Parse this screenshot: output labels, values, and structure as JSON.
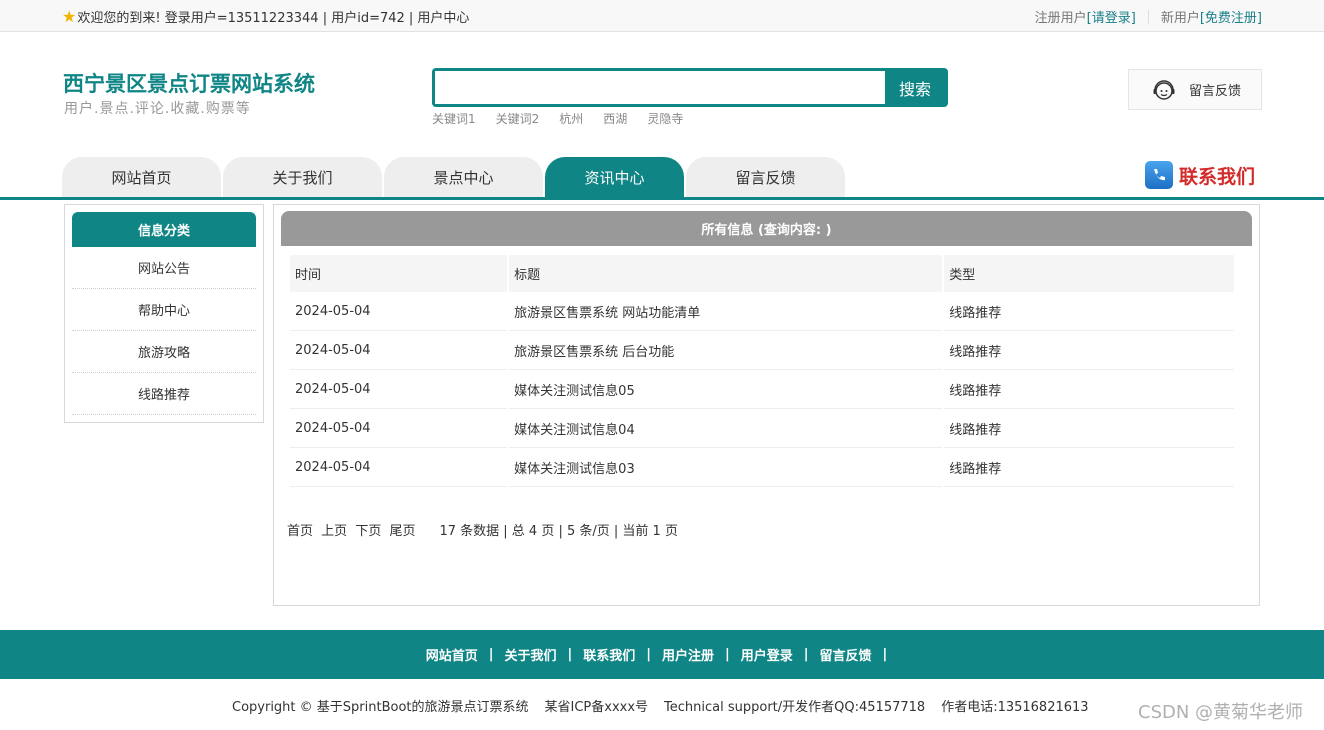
{
  "topbar": {
    "welcome": "欢迎您的到来!  登录用户=13511223344 | 用户id=742 | 用户中心",
    "register_user_label": "注册用户",
    "login_link": "[请登录]",
    "new_user_label": "新用户",
    "free_register_link": "[免费注册]"
  },
  "header": {
    "title": "西宁景区景点订票网站系统",
    "subtitle": "用户.景点.评论.收藏.购票等",
    "search_placeholder": "",
    "search_button": "搜索",
    "keywords": [
      "关键词1",
      "关键词2",
      "杭州",
      "西湖",
      "灵隐寺"
    ],
    "feedback_label": "留言反馈"
  },
  "nav": {
    "items": [
      "网站首页",
      "关于我们",
      "景点中心",
      "资讯中心",
      "留言反馈"
    ],
    "active_index": 3,
    "contact_label": "联系我们"
  },
  "sidebar": {
    "title": "信息分类",
    "items": [
      "网站公告",
      "帮助中心",
      "旅游攻略",
      "线路推荐"
    ]
  },
  "content": {
    "title": "所有信息 (查询内容: )",
    "columns": [
      "时间",
      "标题",
      "类型"
    ],
    "rows": [
      [
        "2024-05-04",
        "旅游景区售票系统 网站功能清单",
        "线路推荐"
      ],
      [
        "2024-05-04",
        "旅游景区售票系统 后台功能",
        "线路推荐"
      ],
      [
        "2024-05-04",
        "媒体关注测试信息05",
        "线路推荐"
      ],
      [
        "2024-05-04",
        "媒体关注测试信息04",
        "线路推荐"
      ],
      [
        "2024-05-04",
        "媒体关注测试信息03",
        "线路推荐"
      ]
    ],
    "pager": {
      "first": "首页",
      "prev": "上页",
      "next": "下页",
      "last": "尾页",
      "info": "17 条数据 | 总 4 页 | 5 条/页 | 当前 1 页"
    }
  },
  "footer": {
    "links": [
      "网站首页",
      "关于我们",
      "联系我们",
      "用户注册",
      "用户登录",
      "留言反馈"
    ],
    "copyright": "Copyright © 基于SprintBoot的旅游景点订票系统",
    "icp": "某省ICP备xxxx号",
    "support": "Technical support/开发作者QQ:45157718",
    "phone": "作者电话:13516821613"
  },
  "watermark": "CSDN @黄菊华老师",
  "colors": {
    "brand": "#0f8585",
    "header_gray": "#999999",
    "contact_red": "#d42a2a"
  }
}
